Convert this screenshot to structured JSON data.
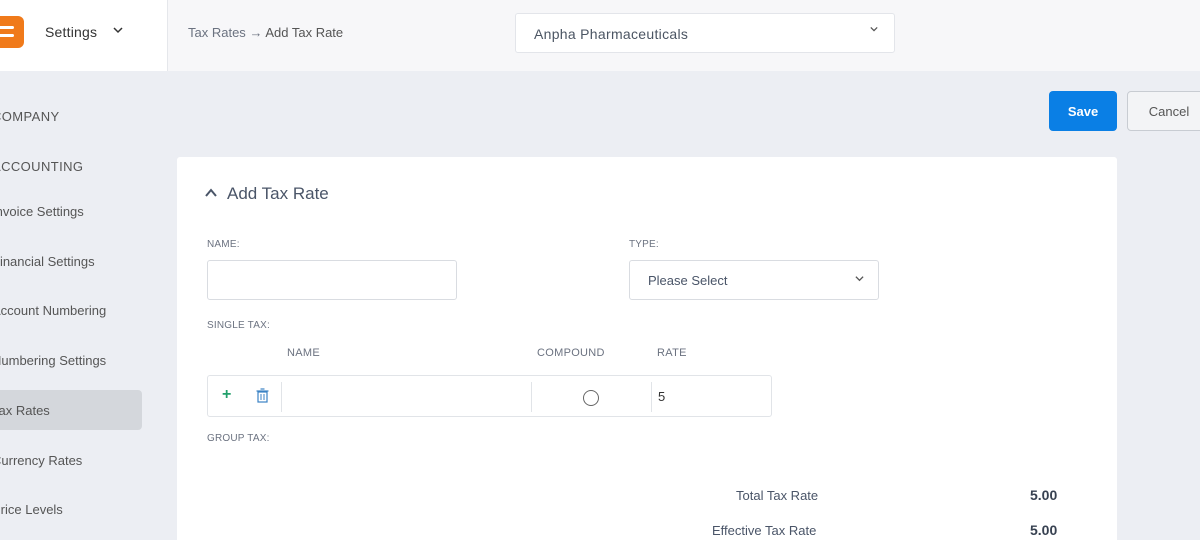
{
  "header": {
    "settings_label": "Settings",
    "breadcrumb_parent": "Tax Rates",
    "breadcrumb_arrow": "→",
    "breadcrumb_current": "Add Tax Rate",
    "company_select_value": "Anpha Pharmaceuticals"
  },
  "sidebar": {
    "sections": [
      {
        "label": "COMPANY"
      },
      {
        "label": "ACCOUNTING"
      }
    ],
    "items": [
      {
        "label": "Invoice Settings"
      },
      {
        "label": "Financial Settings"
      },
      {
        "label": "Account Numbering"
      },
      {
        "label": "Numbering Settings"
      },
      {
        "label": "Tax Rates",
        "active": true
      },
      {
        "label": "Currency Rates"
      },
      {
        "label": "Price Levels"
      }
    ]
  },
  "actions": {
    "save_label": "Save",
    "cancel_label": "Cancel"
  },
  "form": {
    "title": "Add Tax Rate",
    "name_label": "NAME:",
    "name_value": "",
    "type_label": "TYPE:",
    "type_value": "Please Select",
    "single_tax_label": "SINGLE TAX:",
    "columns": [
      "NAME",
      "COMPOUND",
      "RATE"
    ],
    "single_tax_rows": [
      {
        "name": "",
        "compound": false,
        "rate": "5"
      }
    ],
    "group_tax_label": "GROUP TAX:",
    "total_tax_rate_label": "Total Tax Rate",
    "total_tax_rate_value": "5.00",
    "effective_tax_rate_label": "Effective Tax Rate",
    "effective_tax_rate_value": "5.00"
  },
  "colors": {
    "primary": "#0a7fe5",
    "logo": "#f07a1a",
    "add_icon": "#22a06b"
  }
}
